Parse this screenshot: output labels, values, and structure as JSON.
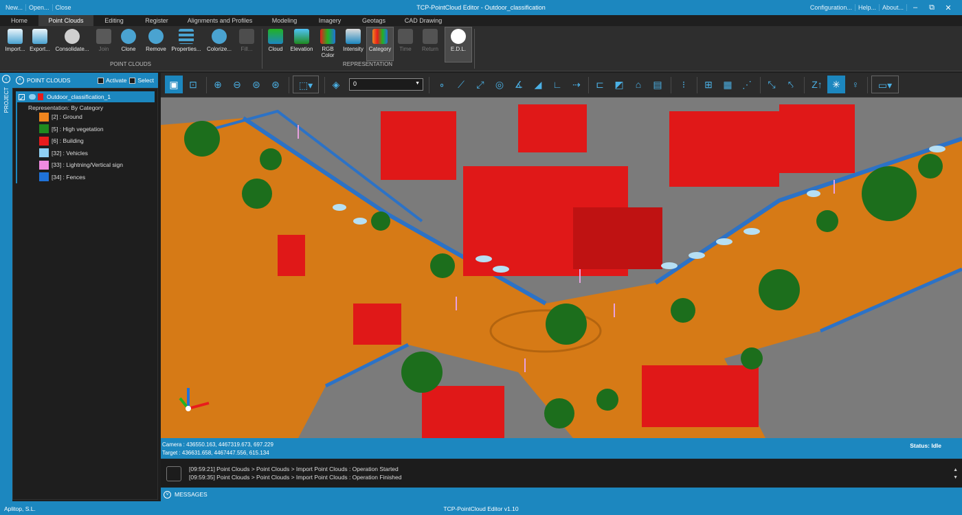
{
  "titlebar": {
    "buttons": [
      "New...",
      "Open...",
      "Close"
    ],
    "title": "TCP-PointCloud Editor - Outdoor_classification",
    "right": [
      "Configuration...",
      "Help...",
      "About..."
    ],
    "controls": [
      "–",
      "⧉",
      "✕"
    ]
  },
  "tabs": [
    "Home",
    "Point Clouds",
    "Editing",
    "Register",
    "Alignments and Profiles",
    "Modeling",
    "Imagery",
    "Geotags",
    "CAD Drawing"
  ],
  "ribbon": {
    "pc": [
      {
        "label": "Import...",
        "icon": "cloud-upload-icon"
      },
      {
        "label": "Export...",
        "icon": "cloud-export-icon"
      },
      {
        "label": "Consolidate...",
        "icon": "consolidate-icon"
      },
      {
        "label": "Join",
        "icon": "join-icon"
      },
      {
        "label": "Clone",
        "icon": "clone-icon"
      },
      {
        "label": "Remove",
        "icon": "remove-icon"
      },
      {
        "label": "Properties...",
        "icon": "properties-icon"
      },
      {
        "label": "Colorize...",
        "icon": "colorize-icon"
      },
      {
        "label": "Fill...",
        "icon": "fill-icon"
      }
    ],
    "group1": "POINT CLOUDS",
    "rep": [
      {
        "label": "Cloud",
        "icon": "cloud-color-icon"
      },
      {
        "label": "Elevation",
        "icon": "elevation-icon"
      },
      {
        "label": "RGB Color",
        "icon": "rgb-icon"
      },
      {
        "label": "Intensity",
        "icon": "intensity-icon"
      },
      {
        "label": "Category",
        "icon": "category-icon"
      },
      {
        "label": "Time",
        "icon": "time-icon"
      },
      {
        "label": "Return",
        "icon": "return-icon"
      },
      {
        "label": "E.D.L.",
        "icon": "edl-icon"
      }
    ],
    "group2": "REPRESENTATION"
  },
  "panel": {
    "side_label": "PROJECT",
    "title": "POINT CLOUDS",
    "activate": "Activate",
    "select": "Select",
    "root": "Outdoor_classification_1",
    "representation": "Representation: By Category",
    "categories": [
      {
        "label": "[2] : Ground",
        "color": "#f0851e"
      },
      {
        "label": "[5] : High vegetation",
        "color": "#1f8a1f"
      },
      {
        "label": "[6] : Building",
        "color": "#e81c1c"
      },
      {
        "label": "[32] : Vehicles",
        "color": "#8fd0f2"
      },
      {
        "label": "[33] : Lightning/Vertical sign",
        "color": "#f08ae0"
      },
      {
        "label": "[34] : Fences",
        "color": "#1f72d9"
      }
    ]
  },
  "combo_value": "0",
  "viewport": {
    "colors": {
      "ground": "#d67a16",
      "building": "#e01818",
      "vegetation": "#1c6e1c",
      "vehicles": "#b6dff3",
      "fences": "#2c72c6",
      "signs": "#e8a0e0",
      "bg": "#7b7b7b"
    }
  },
  "info": {
    "camera": "Camera : 436550.163, 4467319.673, 697.229",
    "target": "Target : 436631.658, 4467447.556, 615.134",
    "status": "Status: Idle"
  },
  "messages": {
    "lines": [
      "[09:59:21] Point Clouds > Point Clouds > Import Point Clouds : Operation Started",
      "[09:59:35] Point Clouds > Point Clouds > Import Point Clouds : Operation Finished"
    ],
    "label": "MESSAGES"
  },
  "footer": {
    "company": "Aplitop, S.L.",
    "version": "TCP-PointCloud Editor v1.10"
  }
}
